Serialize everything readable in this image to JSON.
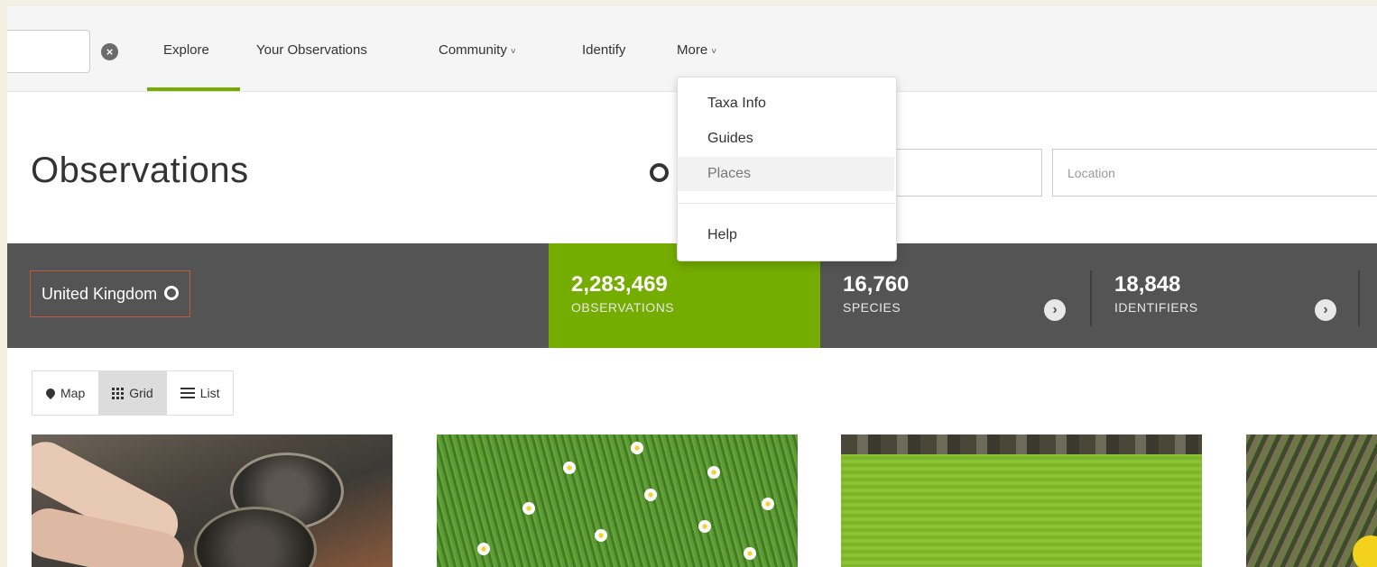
{
  "nav": {
    "items": [
      {
        "label": "Explore"
      },
      {
        "label": "Your Observations"
      },
      {
        "label": "Community",
        "chevron": "˅"
      },
      {
        "label": "Identify"
      },
      {
        "label": "More",
        "chevron": "˅"
      }
    ],
    "active": "Explore"
  },
  "more_menu": {
    "items": [
      "Taxa Info",
      "Guides",
      "Places",
      "Help"
    ],
    "highlighted": "Places"
  },
  "page": {
    "title": "Observations"
  },
  "search": {
    "location_placeholder": "Location"
  },
  "filter": {
    "place": "United Kingdom"
  },
  "stats": [
    {
      "value": "2,283,469",
      "label": "OBSERVATIONS",
      "active": true
    },
    {
      "value": "16,760",
      "label": "SPECIES"
    },
    {
      "value": "18,848",
      "label": "IDENTIFIERS"
    }
  ],
  "view": {
    "options": [
      "Map",
      "Grid",
      "List"
    ],
    "active": "Grid"
  },
  "colors": {
    "accent_green": "#74ac00",
    "stats_bar": "#545454"
  }
}
